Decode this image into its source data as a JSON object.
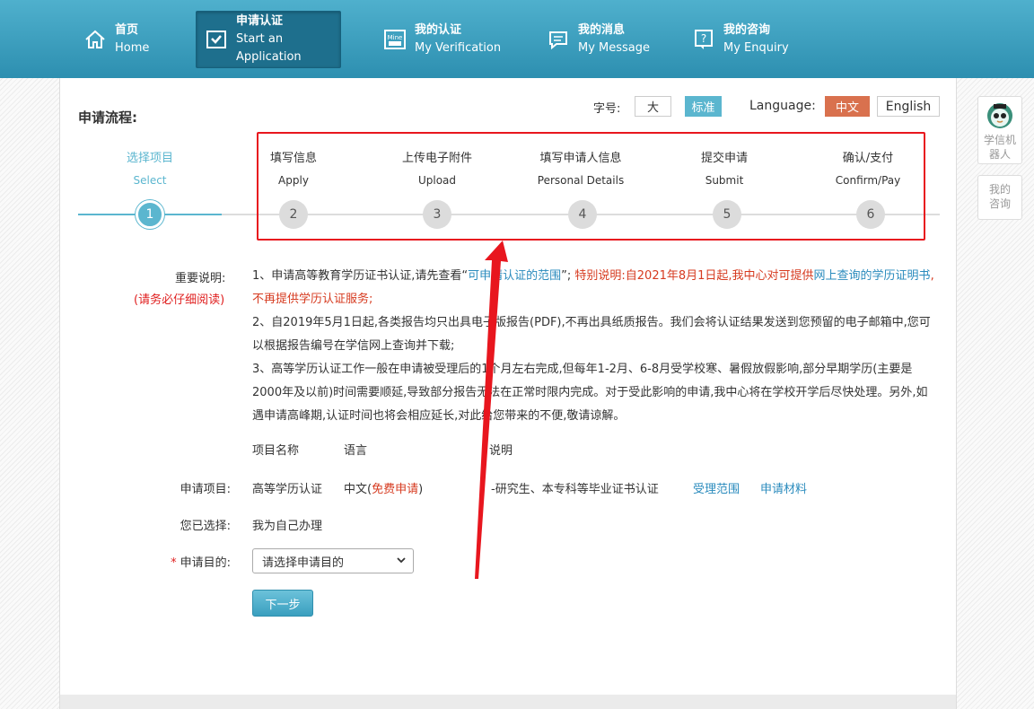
{
  "nav": [
    {
      "zh": "首页",
      "en": "Home",
      "icon": "home-icon"
    },
    {
      "zh": "申请认证",
      "en": "Start an Application",
      "icon": "application-icon"
    },
    {
      "zh": "我的认证",
      "en": "My Verification",
      "icon": "verification-icon"
    },
    {
      "zh": "我的消息",
      "en": "My Message",
      "icon": "message-icon"
    },
    {
      "zh": "我的咨询",
      "en": "My Enquiry",
      "icon": "enquiry-icon"
    }
  ],
  "flow_title": "申请流程:",
  "font_size": {
    "label": "字号:",
    "large": "大",
    "standard": "标准"
  },
  "language": {
    "label": "Language:",
    "zh": "中文",
    "en": "English"
  },
  "steps": [
    {
      "zh": "选择项目",
      "en": "Select",
      "num": "1"
    },
    {
      "zh": "填写信息",
      "en": "Apply",
      "num": "2"
    },
    {
      "zh": "上传电子附件",
      "en": "Upload",
      "num": "3"
    },
    {
      "zh": "填写申请人信息",
      "en": "Personal Details",
      "num": "4"
    },
    {
      "zh": "提交申请",
      "en": "Submit",
      "num": "5"
    },
    {
      "zh": "确认/支付",
      "en": "Confirm/Pay",
      "num": "6"
    }
  ],
  "notes": {
    "label": "重要说明:",
    "sublabel": "(请务必仔细阅读)",
    "p1_a": "1、申请高等教育学历证书认证,请先查看“",
    "p1_link": "可申请认证的范围",
    "p1_b": "”; ",
    "p1_special": "特别说明:自2021年8月1日起,我中心对可提供",
    "p1_link2": "网上查询的学历证明书",
    "p1_special2": ",不再提供学历认证服务;",
    "p2": "2、自2019年5月1日起,各类报告均只出具电子版报告(PDF),不再出具纸质报告。我们会将认证结果发送到您预留的电子邮箱中,您可以根据报告编号在学信网上查询并下载;",
    "p3": "3、高等学历认证工作一般在申请被受理后的1个月左右完成,但每年1-2月、6-8月受学校寒、暑假放假影响,部分早期学历(主要是2000年及以前)时间需要顺延,导致部分报告无法在正常时限内完成。对于受此影响的申请,我中心将在学校开学后尽快处理。另外,如遇申请高峰期,认证时间也将会相应延长,对此给您带来的不便,敬请谅解。"
  },
  "table": {
    "headers": [
      "项目名称",
      "语言",
      "说明"
    ],
    "row_label": "申请项目:",
    "project": "高等学历认证",
    "lang_prefix": "中文(",
    "lang_free": "免费申请",
    "lang_suffix": ")",
    "desc": "-研究生、本专科等毕业证书认证",
    "link_scope": "受理范围",
    "link_materials": "申请材料"
  },
  "selected": {
    "label": "您已选择:",
    "value": "我为自己办理"
  },
  "purpose": {
    "label": "申请目的:",
    "placeholder": "请选择申请目的"
  },
  "next_button": "下一步",
  "side": {
    "robot": "学信机器人",
    "enquiry": "我的咨询"
  }
}
